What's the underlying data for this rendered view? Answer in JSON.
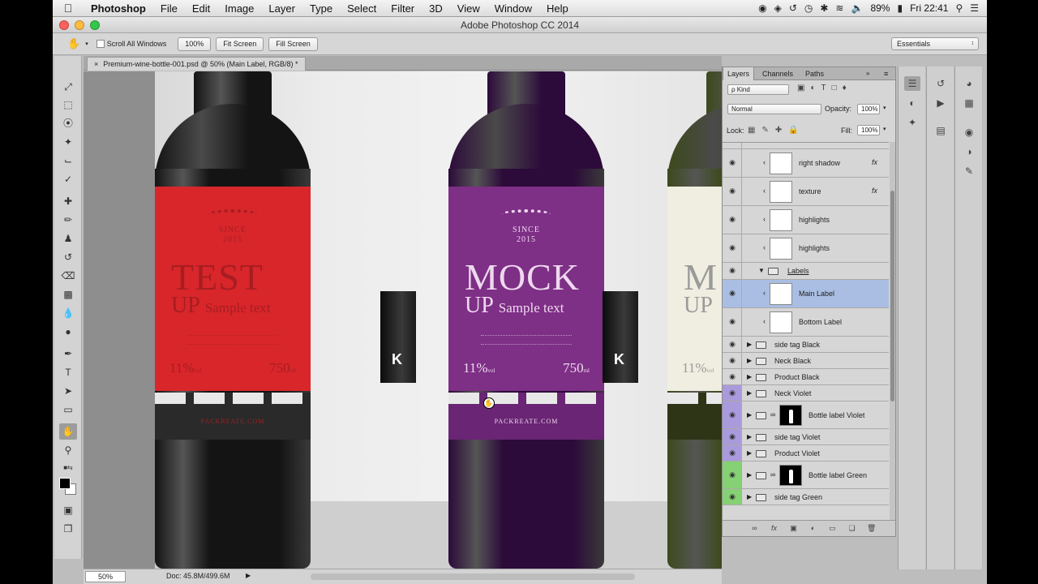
{
  "menubar": {
    "apple_icon": "apple-icon",
    "app_name": "Photoshop",
    "items": [
      "File",
      "Edit",
      "Image",
      "Layer",
      "Type",
      "Select",
      "Filter",
      "3D",
      "View",
      "Window",
      "Help"
    ],
    "battery": "89%",
    "clock": "Fri 22:41"
  },
  "window": {
    "title": "Adobe Photoshop CC 2014"
  },
  "options": {
    "scroll_all": "Scroll All Windows",
    "btn_100": "100%",
    "btn_fit": "Fit Screen",
    "btn_fill": "Fill Screen",
    "workspace": "Essentials"
  },
  "document": {
    "close": "×",
    "tab": "Premium-wine-bottle-001.psd @ 50% (Main Label, RGB/8) *"
  },
  "canvas": {
    "bottles": [
      {
        "name": "Black",
        "colors": {
          "glass": "#141414",
          "label": "#d8262b",
          "text": "#a71d20",
          "band": "#2a2a2a"
        },
        "since": "SINCE\n2015",
        "big": "TEST",
        "up": "UP",
        "sample": "Sample text",
        "pct": "11%",
        "ml": "750",
        "site": "PACKREATE.COM"
      },
      {
        "name": "Violet",
        "colors": {
          "glass": "#2c0a3a",
          "label": "#7e2f86",
          "text": "#eed9ee",
          "band": "#6a2574"
        },
        "since": "SINCE\n2015",
        "big": "MOCK",
        "up": "UP",
        "sample": "Sample text",
        "pct": "11%",
        "ml": "750",
        "site": "PACKREATE.COM"
      },
      {
        "name": "Green",
        "colors": {
          "glass": "#3d4a1b",
          "label": "#efeee0",
          "text": "#9a9a9a",
          "band": "#2e3517"
        },
        "since": "",
        "big": "M",
        "up": "UP",
        "sample": "",
        "pct": "11%",
        "ml": "",
        "site": ""
      }
    ],
    "tag_glyph": "K",
    "unit_pct": "vol",
    "unit_ml": "ml"
  },
  "status": {
    "zoom": "50%",
    "doc": "Doc: 45.8M/499.6M"
  },
  "layers_panel": {
    "tabs": [
      "Layers",
      "Channels",
      "Paths"
    ],
    "filter_kind": "ρ Kind",
    "blend": "Normal",
    "opacity_label": "Opacity:",
    "opacity": "100%",
    "lock_label": "Lock:",
    "fill_label": "Fill:",
    "fill": "100%",
    "rows": [
      {
        "name": "",
        "type": "partial"
      },
      {
        "name": "right shadow",
        "type": "layer",
        "fx": "fx"
      },
      {
        "name": "texture",
        "type": "layer",
        "fx": "fx"
      },
      {
        "name": "highlights",
        "type": "layer"
      },
      {
        "name": "highlights",
        "type": "layer"
      },
      {
        "name": "Labels",
        "type": "group-open"
      },
      {
        "name": "Main Label",
        "type": "layer",
        "selected": true
      },
      {
        "name": "Bottom Label",
        "type": "layer"
      },
      {
        "name": "side tag Black",
        "type": "group"
      },
      {
        "name": "Neck Black",
        "type": "group"
      },
      {
        "name": "Product Black",
        "type": "group"
      },
      {
        "name": "Neck Violet",
        "type": "group",
        "tag": "violet"
      },
      {
        "name": "Bottle label Violet",
        "type": "group-mask",
        "tag": "violet"
      },
      {
        "name": "side tag Violet",
        "type": "group",
        "tag": "violet"
      },
      {
        "name": "Product Violet",
        "type": "group",
        "tag": "violet"
      },
      {
        "name": "Bottle label Green",
        "type": "group-mask",
        "tag": "green"
      },
      {
        "name": "side tag Green",
        "type": "group",
        "tag": "green"
      }
    ],
    "footer_icons": [
      "link-icon",
      "fx-icon",
      "mask-icon",
      "adjustment-icon",
      "group-icon",
      "new-layer-icon",
      "trash-icon"
    ]
  },
  "colors": {
    "violet_tag": "#a99adb",
    "green_tag": "#86d174",
    "selection": "#a9bee2"
  }
}
